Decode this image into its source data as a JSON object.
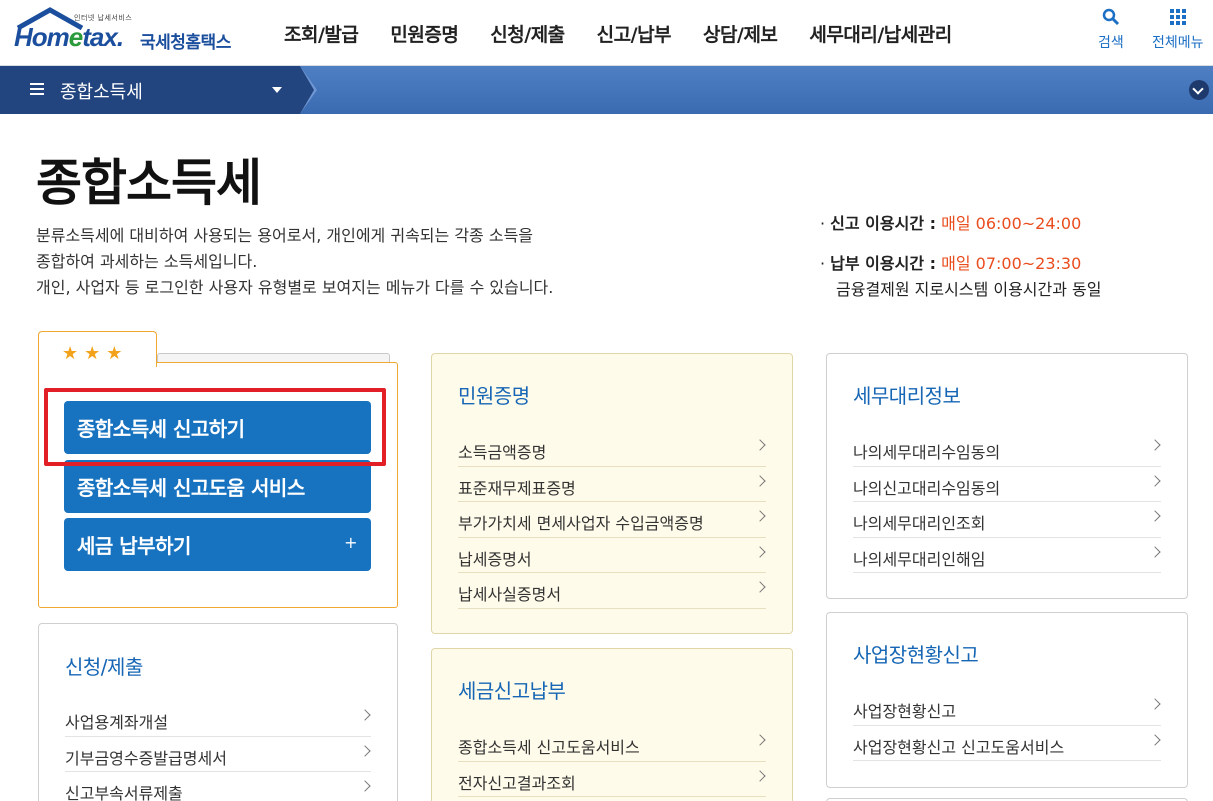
{
  "header": {
    "logo_small": "인터넷 납세서비스",
    "logo_main_a": "Hom",
    "logo_main_e": "e",
    "logo_main_b": "tax.",
    "logo_kor": "국세청홈택스",
    "nav": [
      "조회/발급",
      "민원증명",
      "신청/제출",
      "신고/납부",
      "상담/제보",
      "세무대리/납세관리"
    ],
    "search_label": "검색",
    "all_menu_label": "전체메뉴"
  },
  "subnav": {
    "title": "종합소득세"
  },
  "page": {
    "title": "종합소득세",
    "desc": [
      "분류소득세에 대비하여 사용되는 용어로서, 개인에게 귀속되는 각종 소득을",
      "종합하여 과세하는 소득세입니다.",
      "개인, 사업자 등 로그인한 사용자 유형별로 보여지는 메뉴가 다를 수 있습니다."
    ],
    "times": {
      "report_label": "신고 이용시간 :",
      "report_value": "매일 06:00~24:00",
      "pay_label": "납부 이용시간 :",
      "pay_value": "매일 07:00~23:30",
      "pay_note": "금융결제원 지로시스템 이용시간과 동일"
    }
  },
  "favorites": {
    "stars": [
      "★",
      "★",
      "★"
    ],
    "buttons": [
      "종합소득세 신고하기",
      "종합소득세 신고도움 서비스",
      "세금 납부하기"
    ],
    "plus": "+"
  },
  "cards": {
    "apply": {
      "title": "신청/제출",
      "items": [
        "사업용계좌개설",
        "기부금영수증발급명세서",
        "신고부속서류제출"
      ]
    },
    "minwon": {
      "title": "민원증명",
      "items": [
        "소득금액증명",
        "표준재무제표증명",
        "부가가치세 면세사업자 수입금액증명",
        "납세증명서",
        "납세사실증명서"
      ]
    },
    "tax": {
      "title": "세금신고납부",
      "items": [
        "종합소득세 신고도움서비스",
        "전자신고결과조회"
      ]
    },
    "agent": {
      "title": "세무대리정보",
      "items": [
        "나의세무대리수임동의",
        "나의신고대리수임동의",
        "나의세무대리인조회",
        "나의세무대리인해임"
      ]
    },
    "biz": {
      "title": "사업장현황신고",
      "items": [
        "사업장현황신고",
        "사업장현황신고 신고도움서비스"
      ]
    }
  },
  "colors": {
    "brand_blue": "#1772c0",
    "accent_red": "#ea4c1d",
    "highlight": "#e21f26"
  }
}
